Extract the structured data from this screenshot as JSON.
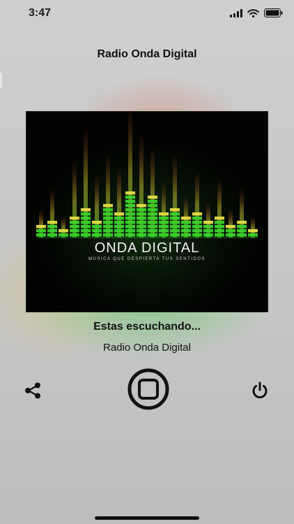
{
  "status_bar": {
    "time": "3:47"
  },
  "header": {
    "title": "Radio Onda Digital"
  },
  "artwork": {
    "logo_text": "ONDA DIGITAL",
    "tagline": "MUSICA QUE DESPIERTA TUS SENTIDOS"
  },
  "now_playing": {
    "heading": "Estas escuchando...",
    "station": "Radio Onda Digital"
  },
  "controls": {
    "share_icon": "share-icon",
    "stop_icon": "stop-icon",
    "power_icon": "power-icon"
  },
  "colors": {
    "equalizer_green": "#3bdc2b",
    "equalizer_yellow": "#e7e23a",
    "equalizer_red": "#e03a1f"
  }
}
